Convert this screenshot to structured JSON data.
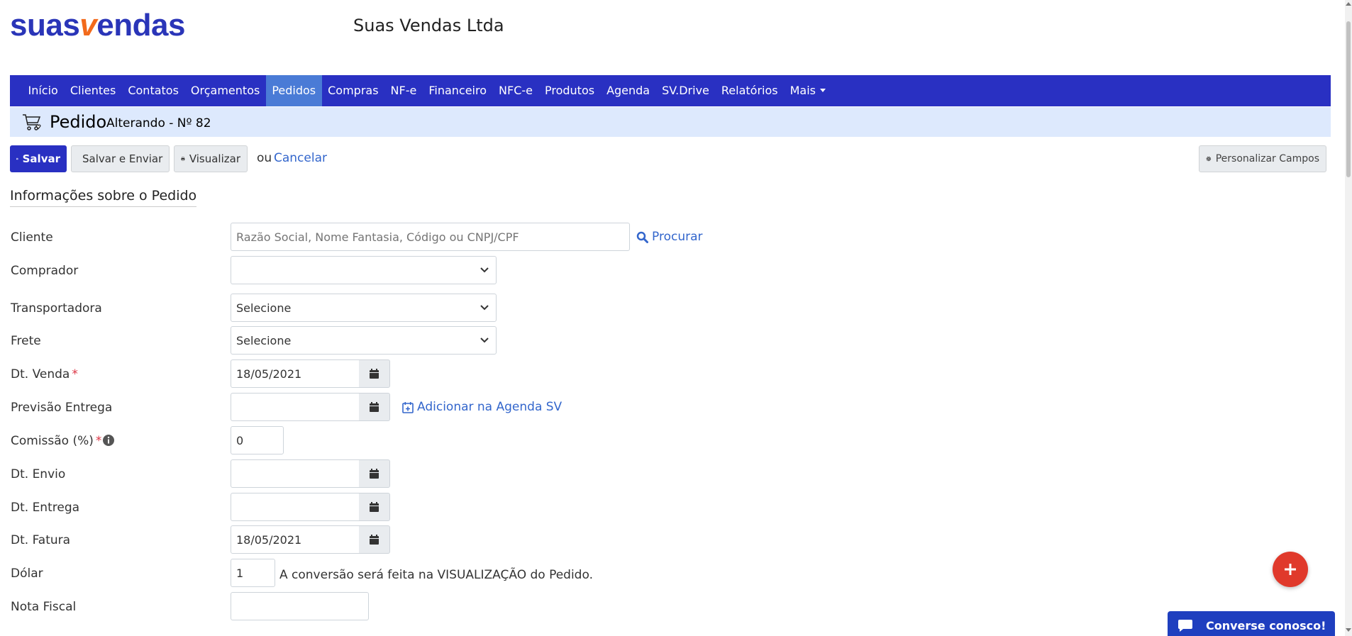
{
  "brand": {
    "logo_part1": "suas",
    "logo_v": "v",
    "logo_part2": "endas",
    "company": "Suas Vendas Ltda"
  },
  "nav": {
    "items": [
      "Início",
      "Clientes",
      "Contatos",
      "Orçamentos",
      "Pedidos",
      "Compras",
      "NF-e",
      "Financeiro",
      "NFC-e",
      "Produtos",
      "Agenda",
      "SV.Drive",
      "Relatórios",
      "Mais"
    ],
    "active": "Pedidos"
  },
  "page": {
    "title": "Pedido",
    "subtitle": "Alterando - Nº 82"
  },
  "toolbar": {
    "save": "Salvar",
    "save_send": "Salvar e Enviar",
    "view": "Visualizar",
    "or": "ou",
    "cancel": "Cancelar",
    "customize": "Personalizar Campos"
  },
  "section": {
    "title": "Informações sobre o Pedido"
  },
  "form": {
    "cliente": {
      "label": "Cliente",
      "placeholder": "Razão Social, Nome Fantasia, Código ou CNPJ/CPF",
      "search": "Procurar"
    },
    "comprador": {
      "label": "Comprador",
      "value": ""
    },
    "transportadora": {
      "label": "Transportadora",
      "value": "Selecione"
    },
    "frete": {
      "label": "Frete",
      "value": "Selecione"
    },
    "dt_venda": {
      "label": "Dt. Venda",
      "value": "18/05/2021",
      "required": "*"
    },
    "previsao_entrega": {
      "label": "Previsão Entrega",
      "value": "",
      "agenda": "Adicionar na Agenda SV"
    },
    "comissao": {
      "label": "Comissão (%)",
      "value": "0",
      "required": "*"
    },
    "dt_envio": {
      "label": "Dt. Envio",
      "value": ""
    },
    "dt_entrega": {
      "label": "Dt. Entrega",
      "value": ""
    },
    "dt_fatura": {
      "label": "Dt. Fatura",
      "value": "18/05/2021"
    },
    "dolar": {
      "label": "Dólar",
      "value": "1",
      "note": "A conversão será feita na VISUALIZAÇÃO do Pedido."
    },
    "nota_fiscal": {
      "label": "Nota Fiscal",
      "value": ""
    }
  },
  "chat": {
    "label": "Converse conosco!"
  },
  "colors": {
    "brand_blue": "#2a35b8",
    "brand_orange": "#f26a1b",
    "nav_bg": "#2930c2",
    "nav_active": "#4a7bd6",
    "title_bg": "#dde9fd",
    "link": "#3366cc",
    "fab": "#e0392b",
    "chat": "#1f3fbf"
  },
  "icons": {
    "cart": "cart-heart-icon",
    "save": "floppy-icon",
    "save_send": "envelope-icon",
    "view": "printer-icon",
    "customize": "gear-icon",
    "search": "search-icon",
    "calendar": "calendar-icon",
    "agenda": "calendar-plus-icon",
    "info": "info-circle-icon",
    "fab": "plus-icon",
    "chat": "chat-bubble-icon"
  }
}
